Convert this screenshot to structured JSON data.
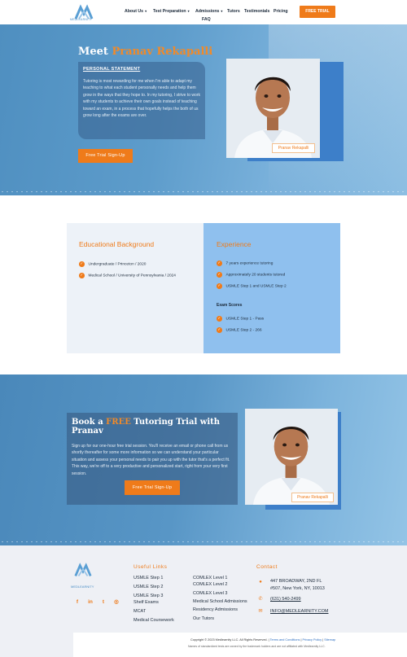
{
  "brand": {
    "logo_text": "MEDLEARNITY",
    "accent": "#ef7b1a",
    "primary": "#4f8fc0"
  },
  "nav": {
    "items": [
      {
        "label": "About Us",
        "has_dropdown": true
      },
      {
        "label": "Test Preparation",
        "has_dropdown": true
      },
      {
        "label": "Admissions",
        "has_dropdown": true
      },
      {
        "label": "Tutors",
        "has_dropdown": false
      },
      {
        "label": "Testimonials",
        "has_dropdown": false
      },
      {
        "label": "Pricing",
        "has_dropdown": false
      },
      {
        "label": "FAQ",
        "has_dropdown": false
      }
    ],
    "cta": "FREE TRIAL"
  },
  "hero": {
    "title_prefix": "Meet ",
    "title_name": "Pranav Rekapalli",
    "ps_heading": "PERSONAL STATEMENT",
    "ps_body": "Tutoring is most rewarding for me when I'm able to adapt my teaching to what each student personally needs and help them grow in the ways that they hope to. In my tutoring, I strive to work with my students to achieve their own goals instead of teaching toward an exam, in a process that hopefully helps the both of us grow long after the exams are over.",
    "cta": "Free Trial Sign-Up",
    "photo_tag": "Pranav Rekapalli"
  },
  "education": {
    "title": "Educational Background",
    "items": [
      "Undergraduate / Princeton / 2020",
      "Medical School / University of Pennsylvania / 2024"
    ]
  },
  "experience": {
    "title": "Experience",
    "items": [
      "7 years experience tutoring",
      "Approximately 20 students tutored",
      "USMLE Step 1 and USMLE Step 2"
    ],
    "scores_heading": "Exam Scores",
    "scores": [
      "USMLE Step 1 - Pass",
      "USMLE Step 2 - 266"
    ]
  },
  "trial": {
    "title_prefix": "Book a ",
    "title_highlight": "FREE",
    "title_suffix": " Tutoring Trial with Pranav",
    "body": "Sign up for our one-hour free trial session. You'll receive an email or phone call from us shortly thereafter for some more information so we can understand your particular situation and assess your personal needs to pair you up with the tutor that's a perfect fit. This way, we're off to a very productive and personalized start, right from your very first session.",
    "cta": "Free Trial Sign-Up",
    "photo_tag": "Pranav Rekapalli"
  },
  "footer": {
    "logo_text": "MEDLEARNITY",
    "social": [
      {
        "icon": "facebook-icon",
        "glyph": "f"
      },
      {
        "icon": "linkedin-icon",
        "glyph": "in"
      },
      {
        "icon": "twitter-icon",
        "glyph": "t"
      },
      {
        "icon": "instagram-icon",
        "glyph": "◎"
      }
    ],
    "links_heading": "Useful Links",
    "links_col1": [
      "USMLE Step 1",
      "USMLE Step 2",
      "USMLE Step 3",
      "Shelf Exams",
      "MCAT",
      "Medical Coursework"
    ],
    "links_col2": [
      "COMLEX Level 1",
      "COMLEX Level 2",
      "COMLEX Level 3",
      "Medical School Admissions",
      "Residency Admissions",
      "Our Tutors"
    ],
    "contact_heading": "Contact",
    "address_line1": "447 BROADWAY, 2ND FL",
    "address_line2": "#507, New York, NY, 10013",
    "phone": "(631) 540-2499",
    "email": "INFO@MEDLEARNITY.COM",
    "copyright": "Copyright © 2023 Medlearnity LLC. All Rights Reserved. |",
    "terms": "Terms and Conditions",
    "privacy": "Privacy Policy",
    "sitemap": "Sitemap",
    "disclaimer": "Names of standardized tests are owned by the trademark holders and are not affiliated with Medlearnity LLC."
  }
}
